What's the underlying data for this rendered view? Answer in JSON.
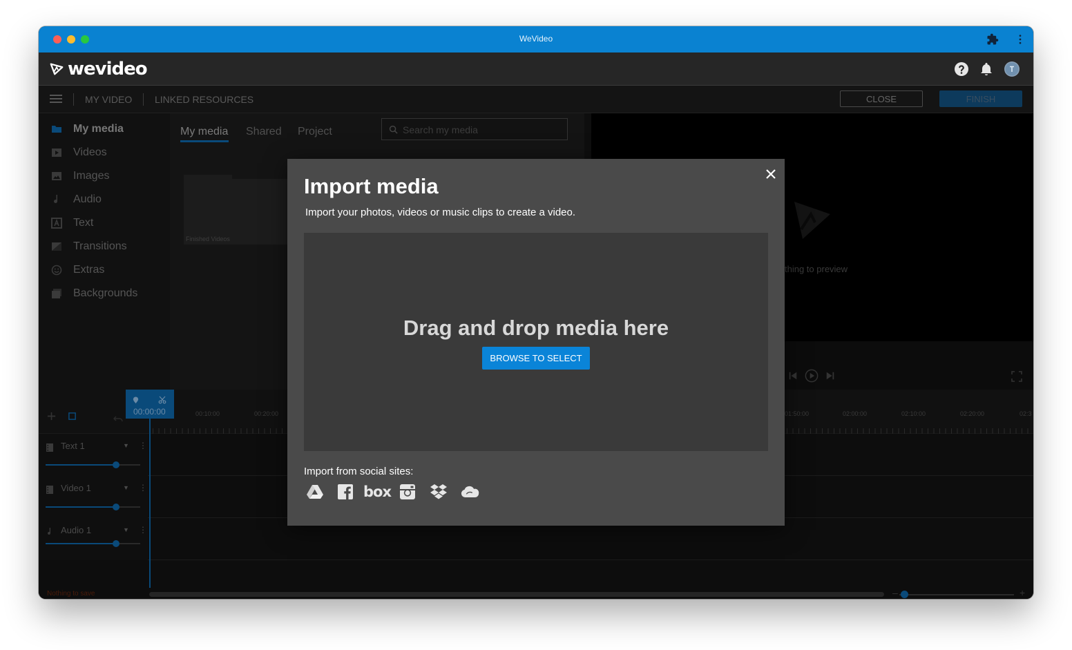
{
  "window": {
    "title": "WeVideo"
  },
  "app": {
    "logo_text": "wevideo"
  },
  "toolbar": {
    "my_video": "MY VIDEO",
    "linked_resources": "LINKED RESOURCES",
    "close_label": "CLOSE",
    "finish_label": "FINISH"
  },
  "sidebar": {
    "items": [
      {
        "label": "My media",
        "icon": "folder-icon"
      },
      {
        "label": "Videos",
        "icon": "video-icon"
      },
      {
        "label": "Images",
        "icon": "image-icon"
      },
      {
        "label": "Audio",
        "icon": "music-note-icon"
      },
      {
        "label": "Text",
        "icon": "text-icon"
      },
      {
        "label": "Transitions",
        "icon": "transition-icon"
      },
      {
        "label": "Extras",
        "icon": "smiley-icon"
      },
      {
        "label": "Backgrounds",
        "icon": "backgrounds-icon"
      }
    ]
  },
  "media": {
    "tabs": [
      {
        "label": "My media"
      },
      {
        "label": "Shared"
      },
      {
        "label": "Project"
      }
    ],
    "search_placeholder": "Search my media",
    "folder_label": "Finished Videos"
  },
  "preview": {
    "empty_text": "thing to preview"
  },
  "timeline": {
    "playhead_time": "00:00:00",
    "times_left": [
      "00:10:00",
      "00:20:00"
    ],
    "times_right": [
      "01:50:00",
      "02:00:00",
      "02:10:00",
      "02:20:00",
      "02:3"
    ],
    "tracks": [
      {
        "name": "Text 1",
        "icon": "film-strip-icon"
      },
      {
        "name": "Video 1",
        "icon": "film-strip-icon"
      },
      {
        "name": "Audio 1",
        "icon": "music-note-icon"
      }
    ],
    "status": "Nothing to save"
  },
  "modal": {
    "title": "Import media",
    "subtitle": "Import your photos, videos or music clips to create a video.",
    "drop_title": "Drag and drop media here",
    "browse_label": "BROWSE TO SELECT",
    "social_label": "Import from social sites:",
    "social_sites": [
      "google-drive-icon",
      "facebook-icon",
      "box-icon",
      "instagram-icon",
      "dropbox-icon",
      "onedrive-icon"
    ],
    "box_text": "box"
  },
  "colors": {
    "titlebar": "#0a82d1",
    "accent": "#0a84d8",
    "modal_bg": "#4a4a4a",
    "dropzone_bg": "#3a3a3a"
  }
}
